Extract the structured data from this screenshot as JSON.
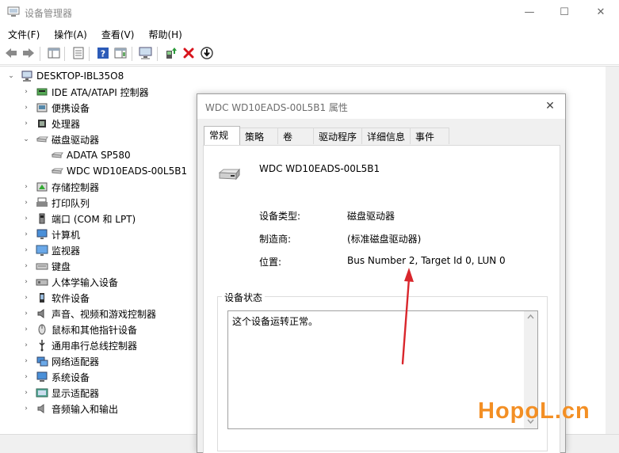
{
  "window": {
    "title": "设备管理器",
    "minimize": "—",
    "maximize": "☐",
    "close": "✕"
  },
  "menu": [
    "文件(F)",
    "操作(A)",
    "查看(V)",
    "帮助(H)"
  ],
  "tree": {
    "root": "DESKTOP-IBL35O8",
    "items": [
      {
        "label": "IDE ATA/ATAPI 控制器",
        "icon": "ide-controller-icon"
      },
      {
        "label": "便携设备",
        "icon": "portable-device-icon"
      },
      {
        "label": "处理器",
        "icon": "processor-icon"
      },
      {
        "label": "磁盘驱动器",
        "icon": "disk-drive-icon",
        "expanded": true,
        "children": [
          {
            "label": "ADATA SP580"
          },
          {
            "label": "WDC WD10EADS-00L5B1"
          }
        ]
      },
      {
        "label": "存储控制器",
        "icon": "storage-controller-icon"
      },
      {
        "label": "打印队列",
        "icon": "printer-icon"
      },
      {
        "label": "端口 (COM 和 LPT)",
        "icon": "port-icon"
      },
      {
        "label": "计算机",
        "icon": "computer-icon"
      },
      {
        "label": "监视器",
        "icon": "monitor-icon"
      },
      {
        "label": "键盘",
        "icon": "keyboard-icon"
      },
      {
        "label": "人体学输入设备",
        "icon": "hid-icon"
      },
      {
        "label": "软件设备",
        "icon": "software-device-icon"
      },
      {
        "label": "声音、视频和游戏控制器",
        "icon": "sound-icon"
      },
      {
        "label": "鼠标和其他指针设备",
        "icon": "mouse-icon"
      },
      {
        "label": "通用串行总线控制器",
        "icon": "usb-icon"
      },
      {
        "label": "网络适配器",
        "icon": "network-icon"
      },
      {
        "label": "系统设备",
        "icon": "system-device-icon"
      },
      {
        "label": "显示适配器",
        "icon": "display-adapter-icon"
      },
      {
        "label": "音频输入和输出",
        "icon": "audio-io-icon"
      }
    ]
  },
  "dialog": {
    "title": "WDC WD10EADS-00L5B1 属性",
    "close": "✕",
    "tabs": [
      "常规",
      "策略",
      "卷",
      "驱动程序",
      "详细信息",
      "事件"
    ],
    "active_tab": "常规",
    "device_name": "WDC WD10EADS-00L5B1",
    "props": [
      {
        "label": "设备类型:",
        "value": "磁盘驱动器"
      },
      {
        "label": "制造商:",
        "value": "(标准磁盘驱动器)"
      },
      {
        "label": "位置:",
        "value": "Bus Number 2, Target Id 0, LUN 0"
      }
    ],
    "status_group_label": "设备状态",
    "status_text": "这个设备运转正常。"
  },
  "watermark": {
    "part1": "HopoL",
    "part2": ".cn"
  },
  "colors": {
    "annotation_arrow": "#d9262c",
    "watermark": "#f38f24"
  }
}
